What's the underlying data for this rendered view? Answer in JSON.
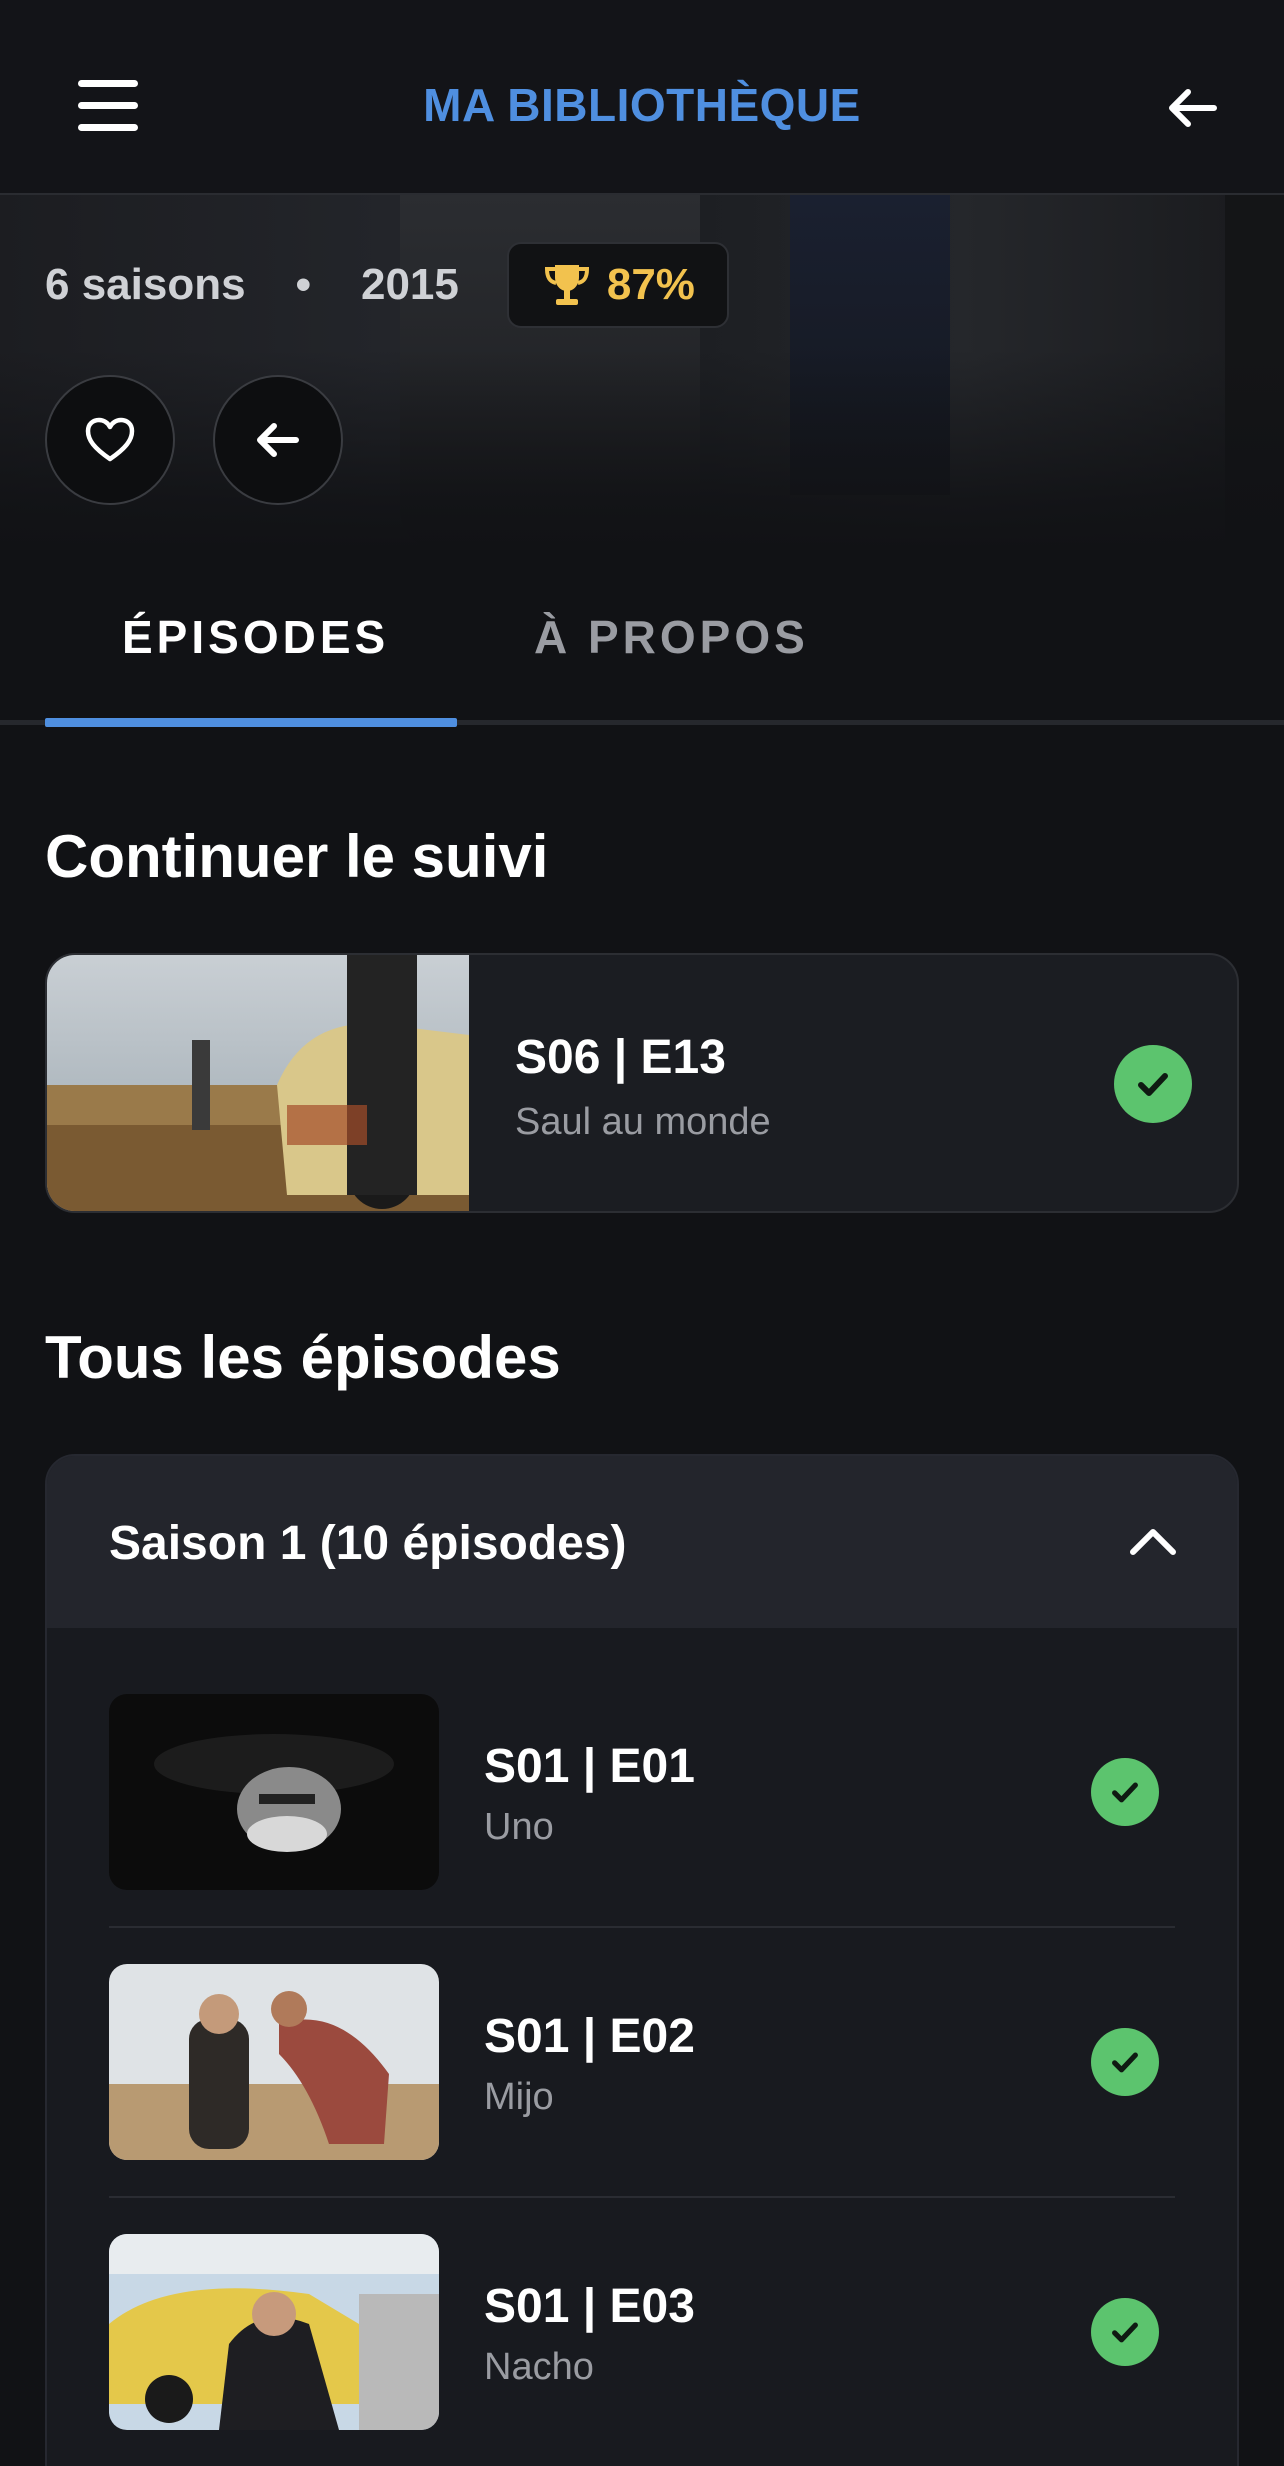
{
  "appbar": {
    "title": "MA BIBLIOTHÈQUE",
    "menu_icon": "hamburger-menu-icon",
    "back_icon": "arrow-left-icon",
    "title_color": "#4f8fe0"
  },
  "show": {
    "seasons": "6 saisons",
    "separator": "•",
    "year": "2015",
    "score": "87%",
    "score_icon": "trophy-icon",
    "score_color": "#f2c24e",
    "favorite_icon": "heart-icon",
    "back_icon": "arrow-left-icon"
  },
  "tabs": [
    {
      "label": "ÉPISODES",
      "active": true
    },
    {
      "label": "À PROPOS",
      "active": false
    }
  ],
  "continue": {
    "title": "Continuer le suivi",
    "episode": {
      "code": "S06 | E13",
      "name": "Saul au monde",
      "watched": true
    }
  },
  "all_episodes": {
    "title": "Tous les épisodes",
    "season": {
      "label": "Saison 1 (10 épisodes)",
      "expanded": true,
      "episodes": [
        {
          "code": "S01 | E01",
          "name": "Uno",
          "watched": true
        },
        {
          "code": "S01 | E02",
          "name": "Mijo",
          "watched": true
        },
        {
          "code": "S01 | E03",
          "name": "Nacho",
          "watched": true
        }
      ]
    }
  },
  "colors": {
    "accent": "#4f8fe0",
    "watched": "#5cc46e",
    "background": "#111215",
    "card": "#1b1d22"
  }
}
